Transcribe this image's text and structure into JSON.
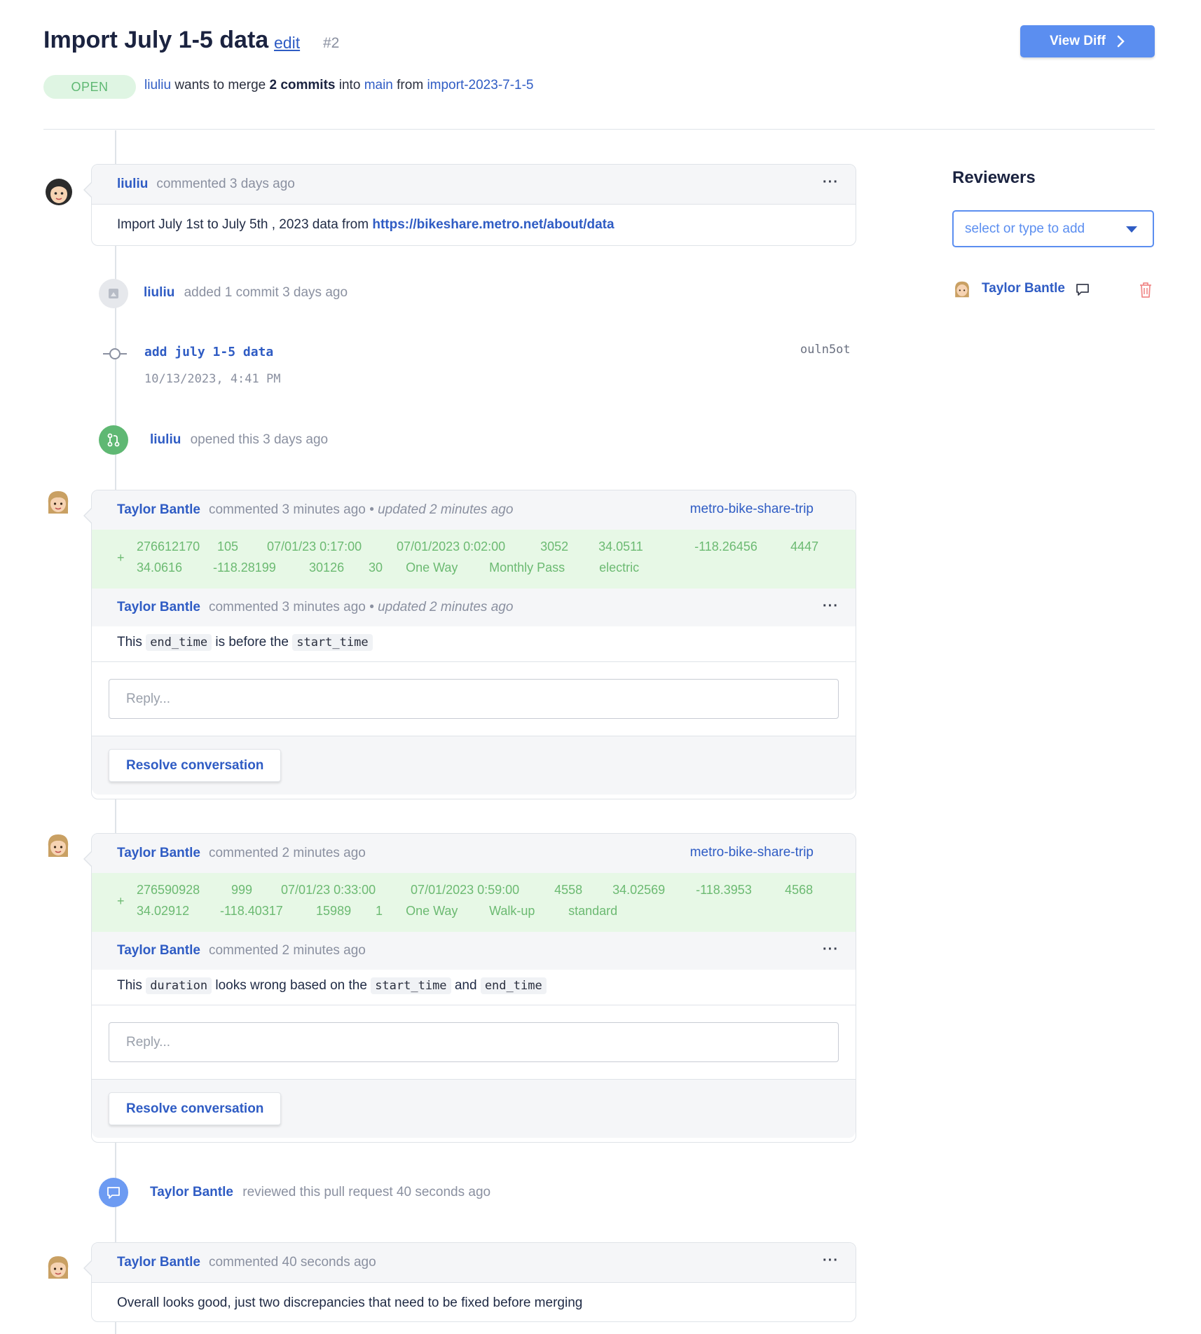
{
  "header": {
    "title": "Import July 1-5 data",
    "edit_label": "edit",
    "pr_number": "#2",
    "view_diff_label": "View Diff",
    "status": "OPEN",
    "merge": {
      "author": "liuliu",
      "text1": "wants to merge",
      "commits": "2 commits",
      "text2": "into",
      "base": "main",
      "text3": "from",
      "head": "import-2023-7-1-5"
    }
  },
  "timeline": {
    "comment1": {
      "author": "liuliu",
      "meta": "commented 3 days ago",
      "more": "···",
      "body_text": "Import July 1st to July 5th , 2023 data from",
      "body_link": "https://bikeshare.metro.net/about/data"
    },
    "commit_event": {
      "author": "liuliu",
      "meta": "added 1 commit 3 days ago",
      "message": "add july 1-5 data",
      "date": "10/13/2023, 4:41 PM",
      "hash": "ouln5ot"
    },
    "open_event": {
      "author": "liuliu",
      "meta": "opened this 3 days ago"
    },
    "thread1": {
      "author": "Taylor Bantle",
      "meta": "commented 3 minutes ago",
      "updated": "• updated 2 minutes ago",
      "table": "metro-bike-share-trip",
      "diff_plus": "+",
      "diff_row1": [
        "276612170",
        "105",
        "07/01/23 0:17:00",
        "07/01/2023 0:02:00",
        "3052",
        "34.0511",
        "-118.26456",
        "4447"
      ],
      "diff_row2": [
        "34.0616",
        "-118.28199",
        "30126",
        "30",
        "One Way",
        "Monthly Pass",
        "electric"
      ],
      "reply_author": "Taylor Bantle",
      "reply_meta": "commented 3 minutes ago",
      "reply_updated": "• updated 2 minutes ago",
      "more": "···",
      "body_pre": "This",
      "code1": "end_time",
      "body_mid": "is before the",
      "code2": "start_time",
      "reply_placeholder": "Reply...",
      "resolve_label": "Resolve conversation"
    },
    "thread2": {
      "author": "Taylor Bantle",
      "meta": "commented 2 minutes ago",
      "table": "metro-bike-share-trip",
      "diff_plus": "+",
      "diff_row1": [
        "276590928",
        "999",
        "07/01/23 0:33:00",
        "07/01/2023 0:59:00",
        "4558",
        "34.02569",
        "-118.3953",
        "4568"
      ],
      "diff_row2": [
        "34.02912",
        "-118.40317",
        "15989",
        "1",
        "One Way",
        "Walk-up",
        "standard"
      ],
      "reply_author": "Taylor Bantle",
      "reply_meta": "commented 2 minutes ago",
      "more": "···",
      "body_pre": "This",
      "code1": "duration",
      "body_mid": "looks wrong based on the",
      "code2": "start_time",
      "body_and": "and",
      "code3": "end_time",
      "reply_placeholder": "Reply...",
      "resolve_label": "Resolve conversation"
    },
    "review_event": {
      "author": "Taylor Bantle",
      "meta": "reviewed this pull request 40 seconds ago"
    },
    "comment_final": {
      "author": "Taylor Bantle",
      "meta": "commented 40 seconds ago",
      "more": "···",
      "body": "Overall looks good, just two discrepancies that need to be fixed before merging"
    }
  },
  "sidebar": {
    "title": "Reviewers",
    "select_placeholder": "select or type to add",
    "reviewer_name": "Taylor Bantle"
  },
  "colors": {
    "accent": "#5b8ef0",
    "link": "#2f5cc4",
    "status_bg": "#dff5e3",
    "status_text": "#5fb873",
    "diff_bg": "#e7f8e6",
    "diff_text": "#6cba72",
    "delete_icon": "#f08a8a"
  },
  "icons": {
    "view_diff": "chevron-right-icon",
    "commit_event": "commit-avatar-icon",
    "commit_node": "commit-node-icon",
    "open_event": "pull-request-icon",
    "review_event": "chat-bubble-icon",
    "reviewer_comment": "comment-icon",
    "reviewer_delete": "trash-icon",
    "select_caret": "caret-down-icon"
  }
}
